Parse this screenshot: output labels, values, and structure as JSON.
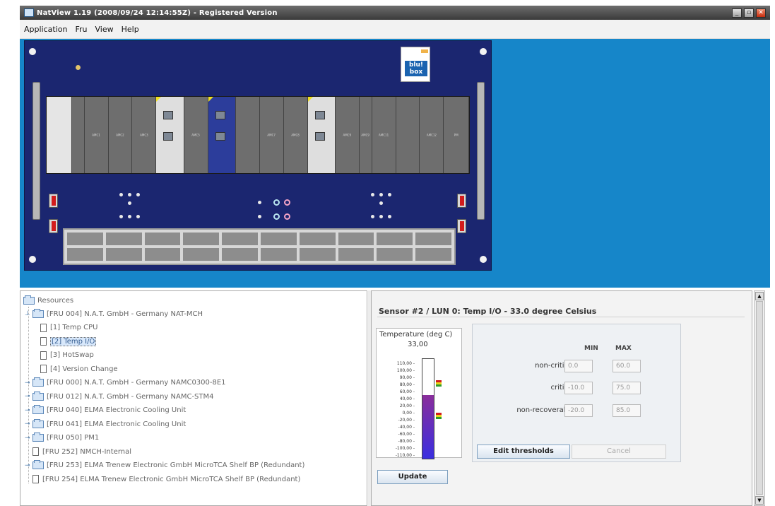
{
  "window": {
    "title": "NatView 1.19  (2008/09/24 12:14:55Z) - Registered Version"
  },
  "menu": [
    "Application",
    "Fru",
    "View",
    "Help"
  ],
  "chassis": {
    "logo_text": "blu!\nbox",
    "slots": [
      "",
      "",
      "AMC1",
      "AMC2",
      "AMC3",
      "",
      "AMC5",
      "",
      "",
      "AMC7",
      "AMC8",
      "",
      "AMC9",
      "AMC9",
      "AMC11",
      "",
      "AMC12",
      "PM"
    ]
  },
  "resources": {
    "root": "Resources",
    "items": [
      {
        "label": "[FRU 004] N.A.T. GmbH - Germany NAT-MCH",
        "type": "folder",
        "expanded": true,
        "level": 1
      },
      {
        "label": "[1] Temp CPU",
        "type": "file",
        "level": 2
      },
      {
        "label": "[2] Temp I/O",
        "type": "file",
        "level": 2,
        "selected": true
      },
      {
        "label": "[3] HotSwap",
        "type": "file",
        "level": 2
      },
      {
        "label": "[4] Version Change",
        "type": "file",
        "level": 2
      },
      {
        "label": "[FRU 000] N.A.T. GmbH - Germany NAMC0300-8E1",
        "type": "folder",
        "level": 1
      },
      {
        "label": "[FRU 012] N.A.T. GmbH - Germany NAMC-STM4",
        "type": "folder",
        "level": 1
      },
      {
        "label": "[FRU 040] ELMA Electronic Cooling Unit",
        "type": "folder",
        "level": 1
      },
      {
        "label": "[FRU 041] ELMA Electronic Cooling Unit",
        "type": "folder",
        "level": 1
      },
      {
        "label": "[FRU 050] PM1",
        "type": "folder",
        "level": 1
      },
      {
        "label": "[FRU 252] NMCH-Internal",
        "type": "file",
        "level": 1
      },
      {
        "label": "[FRU 253] ELMA Trenew Electronic GmbH MicroTCA Shelf BP (Redundant)",
        "type": "folder",
        "level": 1
      },
      {
        "label": "[FRU 254] ELMA Trenew Electronic GmbH MicroTCA Shelf BP (Redundant)",
        "type": "file",
        "level": 1
      }
    ]
  },
  "sensor": {
    "title": "Sensor #2 / LUN 0: Temp I/O - 33.0 degree Celsius",
    "gauge": {
      "label": "Temperature (deg C)",
      "value_text": "33,00",
      "ticks": [
        "110,00",
        "100,00",
        "90,00",
        "80,00",
        "60,00",
        "40,00",
        "20,00",
        "0,00",
        "-20,00",
        "-40,00",
        "-60,00",
        "-80,00",
        "-100,00",
        "-110,00"
      ],
      "min": -120,
      "max": 120,
      "value": 33
    },
    "thresholds": {
      "col_min": "MIN",
      "col_max": "MAX",
      "rows": [
        {
          "label": "non-critical",
          "min": "0.0",
          "max": "60.0"
        },
        {
          "label": "critical",
          "min": "-10.0",
          "max": "75.0"
        },
        {
          "label": "non-recoverable",
          "min": "-20.0",
          "max": "85.0"
        }
      ]
    },
    "buttons": {
      "edit": "Edit thresholds",
      "cancel": "Cancel",
      "update": "Update"
    }
  }
}
